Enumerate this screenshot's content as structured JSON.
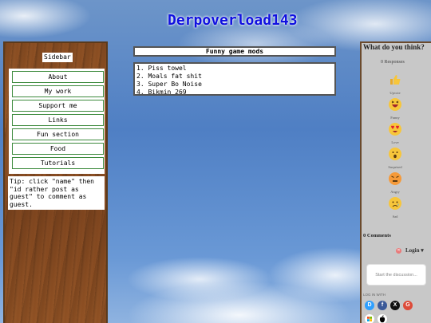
{
  "site": {
    "title": "Derpoverload143"
  },
  "sidebar": {
    "title": "Sidebar",
    "items": [
      {
        "label": "About"
      },
      {
        "label": "My work"
      },
      {
        "label": "Support me"
      },
      {
        "label": "Links"
      },
      {
        "label": "Fun section"
      },
      {
        "label": "Food"
      },
      {
        "label": "Tutorials"
      }
    ],
    "tip": "Tip: click \"name\" then \"id rather post as guest\" to comment as guest."
  },
  "main": {
    "mods_title": "Funny game mods",
    "mods": [
      "1. Piss towel",
      "2. Moals fat shit",
      "3. Super Bo Noise",
      "4. Bikmin 269"
    ]
  },
  "comments": {
    "heading": "What do you think?",
    "responses": "0 Responses",
    "reactions": [
      {
        "label": "Upvote",
        "icon": "thumbs-up-icon"
      },
      {
        "label": "Funny",
        "icon": "laughing-face-icon"
      },
      {
        "label": "Love",
        "icon": "heart-eyes-face-icon"
      },
      {
        "label": "Surprised",
        "icon": "surprised-face-icon"
      },
      {
        "label": "Angry",
        "icon": "angry-face-icon"
      },
      {
        "label": "Sad",
        "icon": "sad-face-icon"
      }
    ],
    "count": "0 Comments",
    "login": "Login ▾",
    "input_placeholder": "Start the discussion...",
    "log_in_with": "LOG IN WITH",
    "providers": [
      "D",
      "f",
      "X",
      "G",
      "M",
      ""
    ],
    "colors": {
      "disqus": "#2e9fff",
      "facebook": "#3b5998",
      "x": "#111111",
      "google": "#dd4b39",
      "microsoft": "#f3f3f3",
      "apple": "#000000"
    }
  }
}
